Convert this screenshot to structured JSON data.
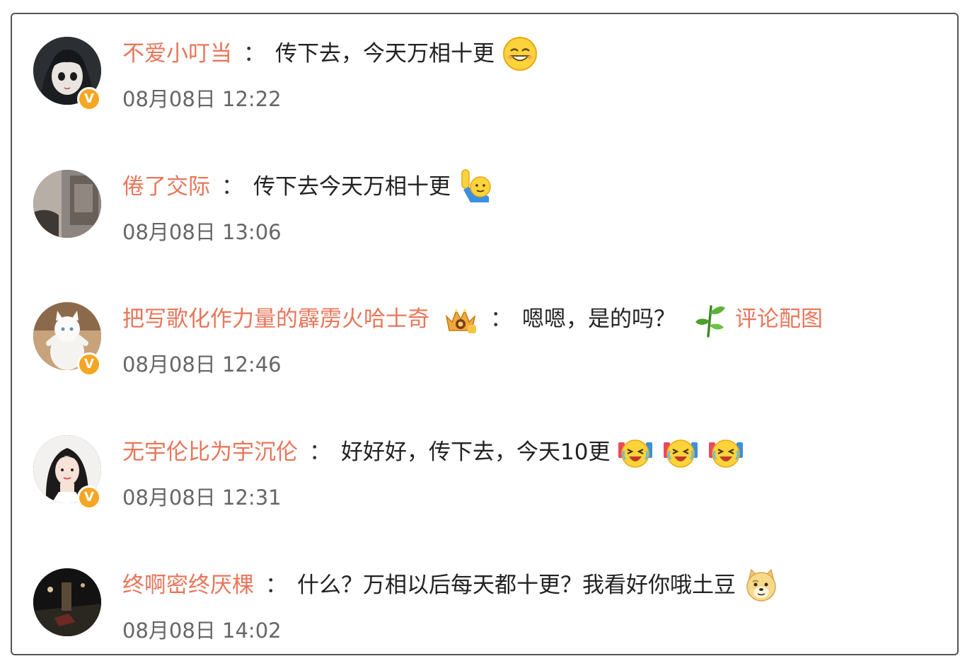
{
  "comments": [
    {
      "username": "不爱小叮当",
      "separator": "：",
      "text": "传下去，今天万相十更",
      "emojis": [
        "grin-face-emoji"
      ],
      "link": "",
      "time": "08月08日 12:22",
      "verified": true,
      "avatar": "anime-girl-avatar"
    },
    {
      "username": "倦了交际",
      "separator": "：",
      "text": "传下去今天万相十更",
      "emojis": [
        "raise-hand-emoji"
      ],
      "link": "",
      "time": "08月08日 13:06",
      "verified": false,
      "avatar": "room-photo-avatar"
    },
    {
      "username": "把写歌化作力量的霹雳火哈士奇",
      "separator": "：",
      "text": "嗯嗯，是的吗？",
      "emojis": [],
      "link": "评论配图",
      "time": "08月08日 12:46",
      "verified": true,
      "avatar": "white-cat-avatar",
      "badge": "crown-level-badge"
    },
    {
      "username": "无宇伦比为宇沉伦",
      "separator": "：",
      "text": "好好好，传下去，今天10更",
      "emojis": [
        "cheer-face-emoji",
        "cheer-face-emoji",
        "cheer-face-emoji"
      ],
      "link": "",
      "time": "08月08日 12:31",
      "verified": true,
      "avatar": "woman-portrait-avatar"
    },
    {
      "username": "终啊密终厌棵",
      "separator": "：",
      "text": "什么？万相以后每天都十更？我看好你哦土豆",
      "emojis": [
        "doge-emoji"
      ],
      "link": "",
      "time": "08月08日 14:02",
      "verified": false,
      "avatar": "dark-street-avatar"
    }
  ],
  "verified_mark": "V",
  "colors": {
    "username": "#e8765a",
    "text": "#222222",
    "time": "#666666",
    "verified_badge": "#f5a623"
  }
}
